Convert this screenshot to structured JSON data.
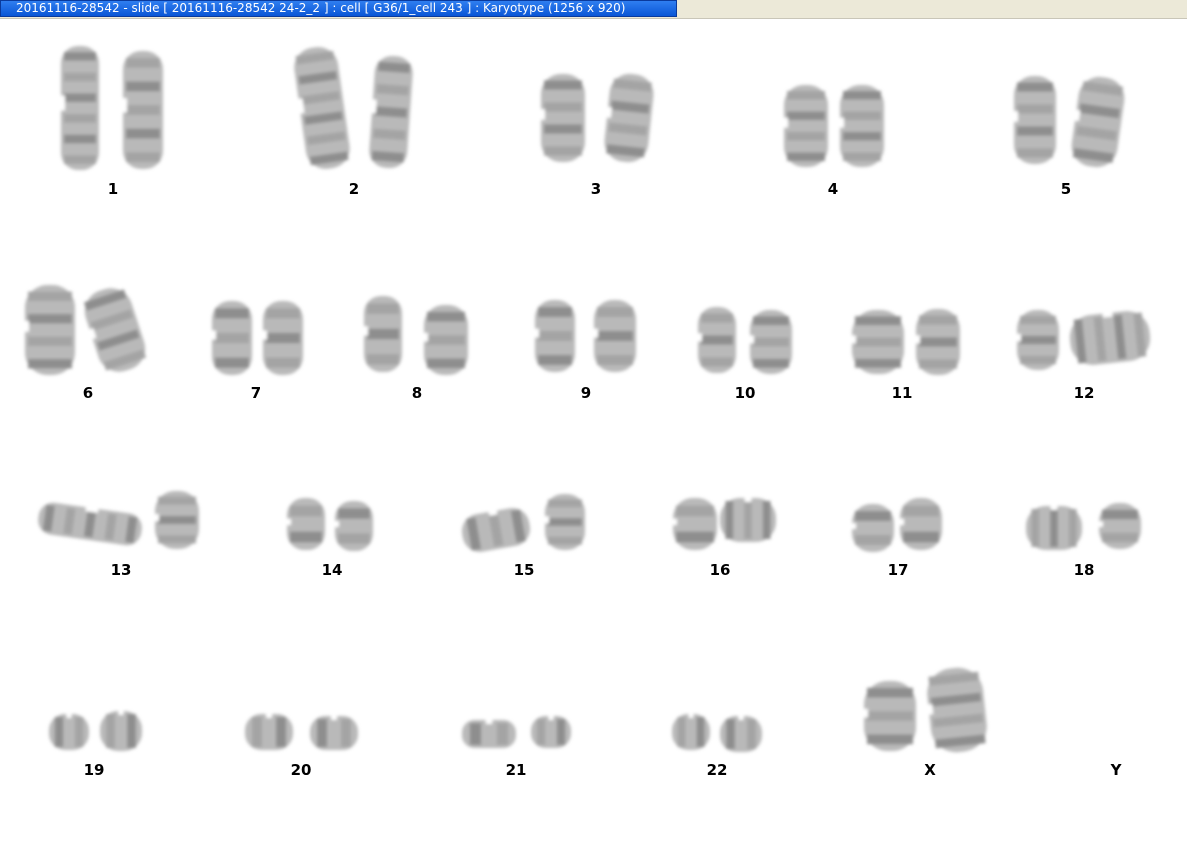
{
  "window": {
    "title": "20161116-28542 - slide [ 20161116-28542 24-2_2 ] : cell [ G36/1_cell 243 ] : Karyotype  (1256 x 920)"
  },
  "karyotype": {
    "chromosome_labels": [
      "1",
      "2",
      "3",
      "4",
      "5",
      "6",
      "7",
      "8",
      "9",
      "10",
      "11",
      "12",
      "13",
      "14",
      "15",
      "16",
      "17",
      "18",
      "19",
      "20",
      "21",
      "22",
      "X",
      "Y"
    ]
  }
}
